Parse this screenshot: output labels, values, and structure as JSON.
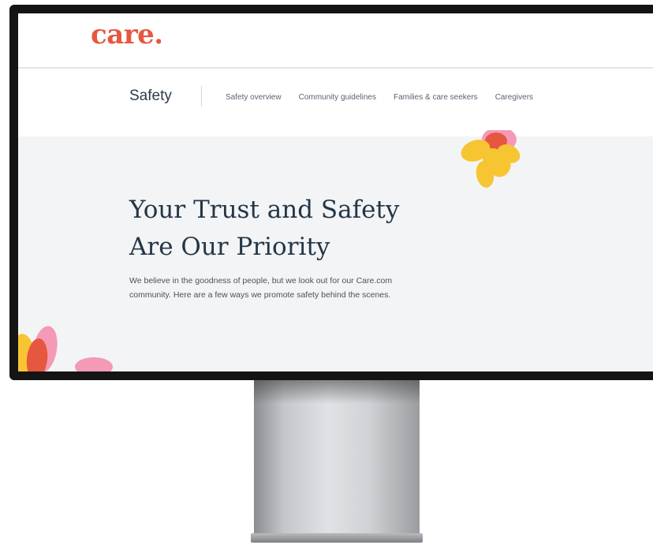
{
  "brand": {
    "logo_text": "care.",
    "accent_color": "#e5573f"
  },
  "subnav": {
    "title": "Safety",
    "links": [
      {
        "label": "Safety overview"
      },
      {
        "label": "Community guidelines"
      },
      {
        "label": "Families & care seekers"
      },
      {
        "label": "Caregivers"
      }
    ]
  },
  "hero": {
    "title_line1": "Your Trust and Safety",
    "title_line2": "Are Our Priority",
    "body": "We believe in the goodness of people, but we look out for our Care.com community. Here are a few ways we promote safety behind the scenes.",
    "background_color": "#f3f4f6"
  },
  "decor": {
    "flower_colors": [
      "#f7c531",
      "#e5573f",
      "#f49ab6"
    ]
  }
}
